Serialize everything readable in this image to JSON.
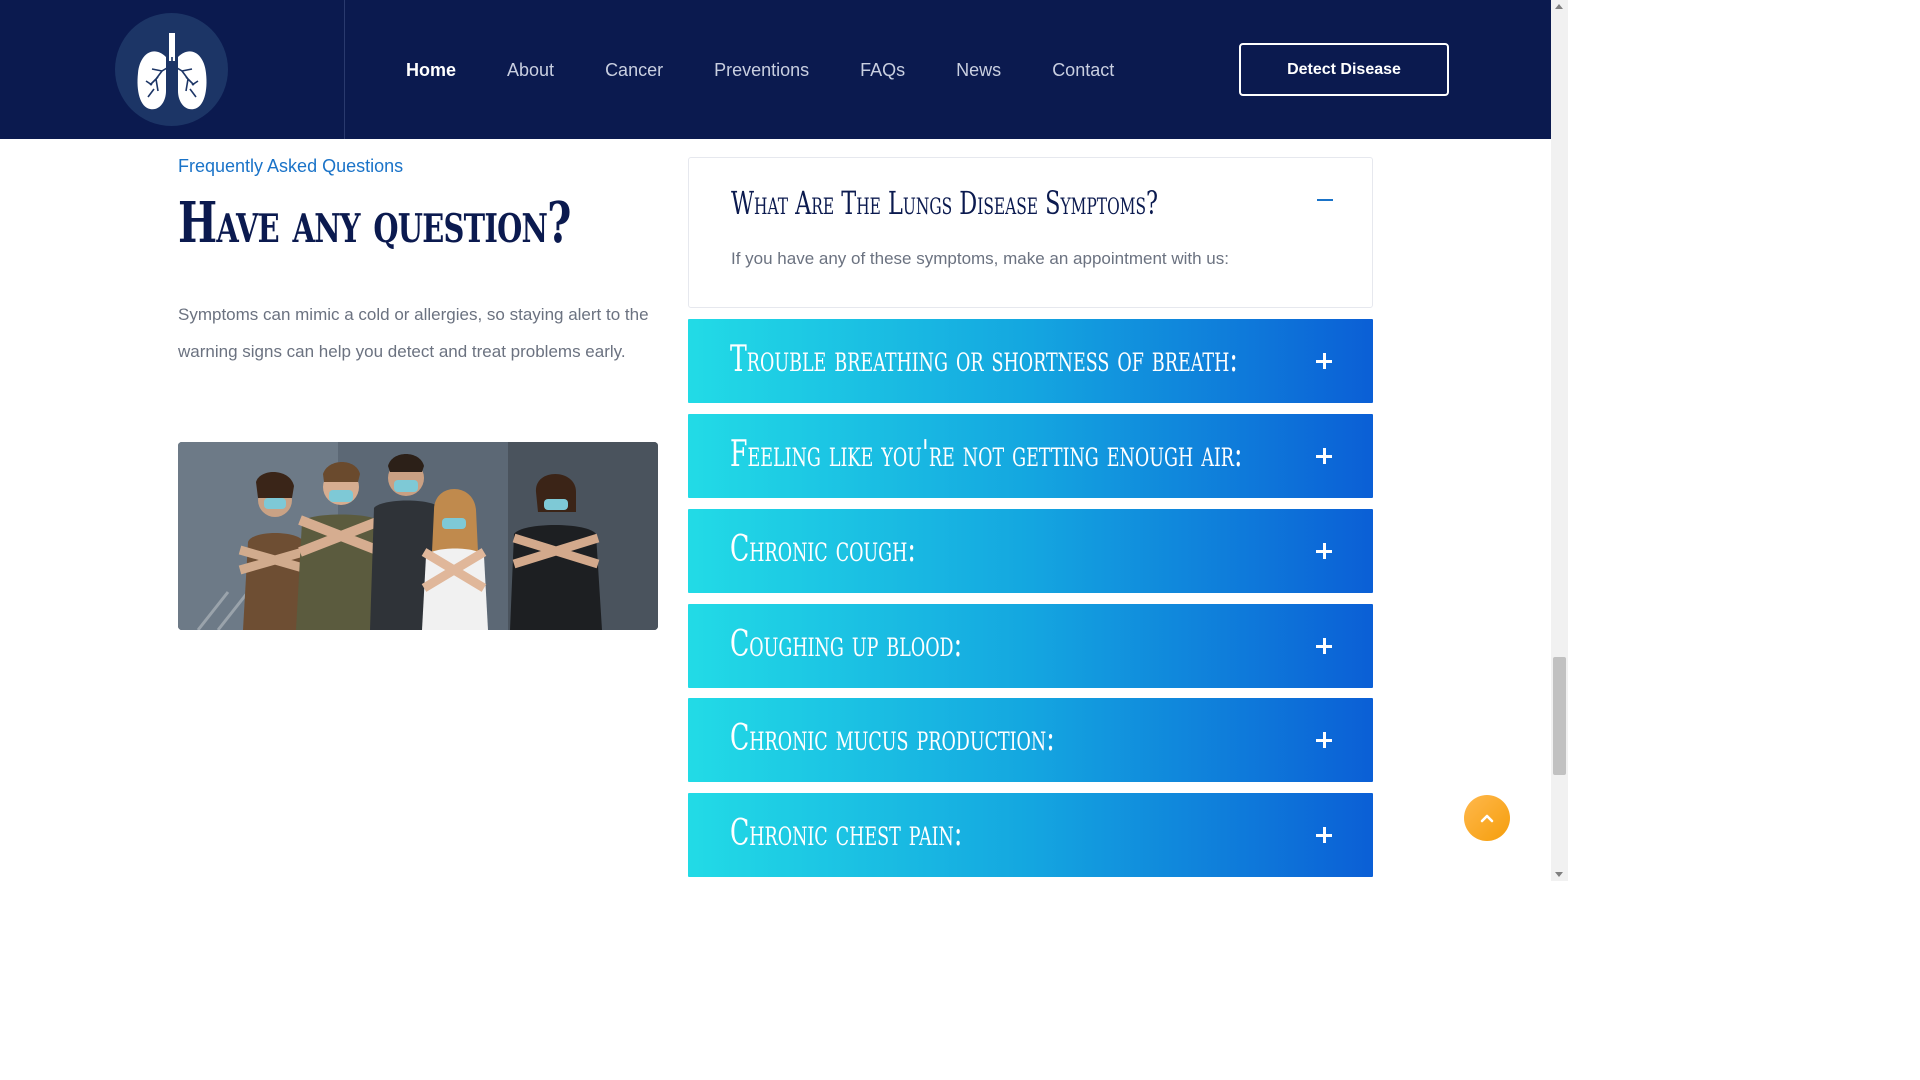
{
  "colors": {
    "header_bg": "#0b1a4f",
    "accent_blue": "#1a73c8",
    "accordion_gradient_start": "#22dbe6",
    "accordion_gradient_end": "#0b5fd6",
    "back_to_top": "#f59e0b"
  },
  "header": {
    "logo_icon": "lungs-icon",
    "nav": [
      {
        "label": "Home",
        "active": true
      },
      {
        "label": "About"
      },
      {
        "label": "Cancer"
      },
      {
        "label": "Preventions"
      },
      {
        "label": "FAQs"
      },
      {
        "label": "News"
      },
      {
        "label": "Contact"
      }
    ],
    "cta_label": "Detect Disease"
  },
  "intro": {
    "eyebrow": "Frequently Asked Questions",
    "title": "Have any question?",
    "description": "Symptoms can mimic a cold or allergies, so staying alert to the warning signs can help you detect and treat problems early."
  },
  "faq": {
    "open_item": {
      "question": "What Are The Lungs Disease Symptoms?",
      "answer": "If you have any of these symptoms, make an appointment with us:",
      "icon": "minus-icon"
    },
    "items": [
      {
        "question": "Trouble breathing or shortness of breath:",
        "icon": "plus-icon"
      },
      {
        "question": "Feeling like you're not getting enough air:",
        "icon": "plus-icon"
      },
      {
        "question": "Chronic cough:",
        "icon": "plus-icon"
      },
      {
        "question": "Coughing up blood:",
        "icon": "plus-icon"
      },
      {
        "question": "Chronic mucus production:",
        "icon": "plus-icon"
      },
      {
        "question": "Chronic chest pain:",
        "icon": "plus-icon"
      }
    ]
  },
  "back_to_top_icon": "chevron-up-icon"
}
